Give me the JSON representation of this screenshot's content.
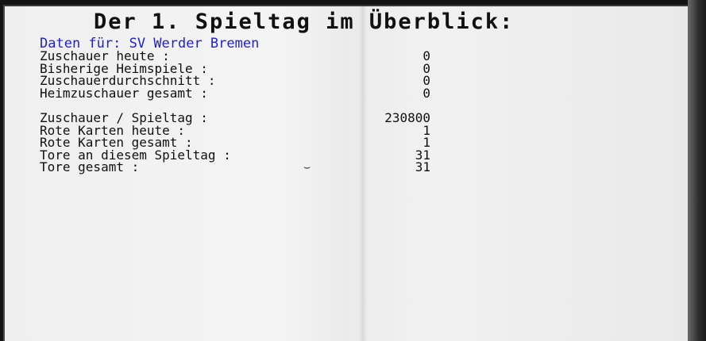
{
  "screen": {
    "title": "Der 1. Spieltag im Überblick:",
    "club_line": "Daten für: SV Werder Bremen",
    "stats_group_1": [
      {
        "label": "Zuschauer heute :",
        "value": "0"
      },
      {
        "label": "Bisherige Heimspiele :",
        "value": "0"
      },
      {
        "label": "Zuschauerdurchschnitt :",
        "value": "0"
      },
      {
        "label": "Heimzuschauer gesamt :",
        "value": "0"
      }
    ],
    "stats_group_2": [
      {
        "label": "Zuschauer / Spieltag :",
        "value": "230800"
      },
      {
        "label": "Rote Karten heute :",
        "value": "1"
      },
      {
        "label": "Rote Karten gesamt :",
        "value": "1"
      },
      {
        "label": "Tore an diesem Spieltag :",
        "value": "31"
      },
      {
        "label": "Tore gesamt :",
        "value": "31"
      }
    ],
    "cursor_glyph": "⌣"
  },
  "colors": {
    "text": "#101010",
    "club_accent": "#2020d8",
    "paper": "#efefef"
  }
}
